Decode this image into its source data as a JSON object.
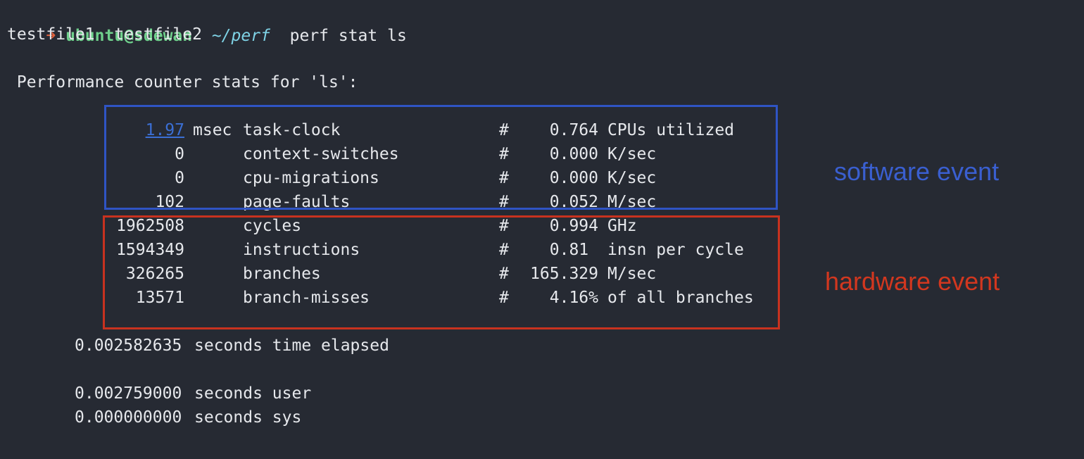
{
  "prompt": {
    "arrow": "➜",
    "user_host": "ubuntu@sdewan",
    "path": "~/perf",
    "command": "perf stat ls"
  },
  "ls_output": "testfile1  testfile2",
  "stats_header": " Performance counter stats for 'ls':",
  "stats": [
    {
      "value": "1.97",
      "unit": "msec",
      "event": "task-clock",
      "hash": "#",
      "metric": "0.764",
      "desc": "CPUs utilized"
    },
    {
      "value": "0",
      "unit": "",
      "event": "context-switches",
      "hash": "#",
      "metric": "0.000",
      "desc": "K/sec"
    },
    {
      "value": "0",
      "unit": "",
      "event": "cpu-migrations",
      "hash": "#",
      "metric": "0.000",
      "desc": "K/sec"
    },
    {
      "value": "102",
      "unit": "",
      "event": "page-faults",
      "hash": "#",
      "metric": "0.052",
      "desc": "M/sec"
    },
    {
      "value": "1962508",
      "unit": "",
      "event": "cycles",
      "hash": "#",
      "metric": "0.994",
      "desc": "GHz"
    },
    {
      "value": "1594349",
      "unit": "",
      "event": "instructions",
      "hash": "#",
      "metric": "0.81 ",
      "desc": "insn per cycle"
    },
    {
      "value": "326265",
      "unit": "",
      "event": "branches",
      "hash": "#",
      "metric": "165.329",
      "desc": "M/sec"
    },
    {
      "value": "13571",
      "unit": "",
      "event": "branch-misses",
      "hash": "#",
      "metric": "4.16%",
      "desc": "of all branches"
    }
  ],
  "times": [
    {
      "value": "0.002582635",
      "desc": "seconds time elapsed"
    },
    {
      "value": "0.002759000",
      "desc": "seconds user"
    },
    {
      "value": "0.000000000",
      "desc": "seconds sys"
    }
  ],
  "annotations": {
    "software_label": "software event",
    "hardware_label": "hardware event",
    "software_color": "#2f54c4",
    "hardware_color": "#c8321f"
  }
}
